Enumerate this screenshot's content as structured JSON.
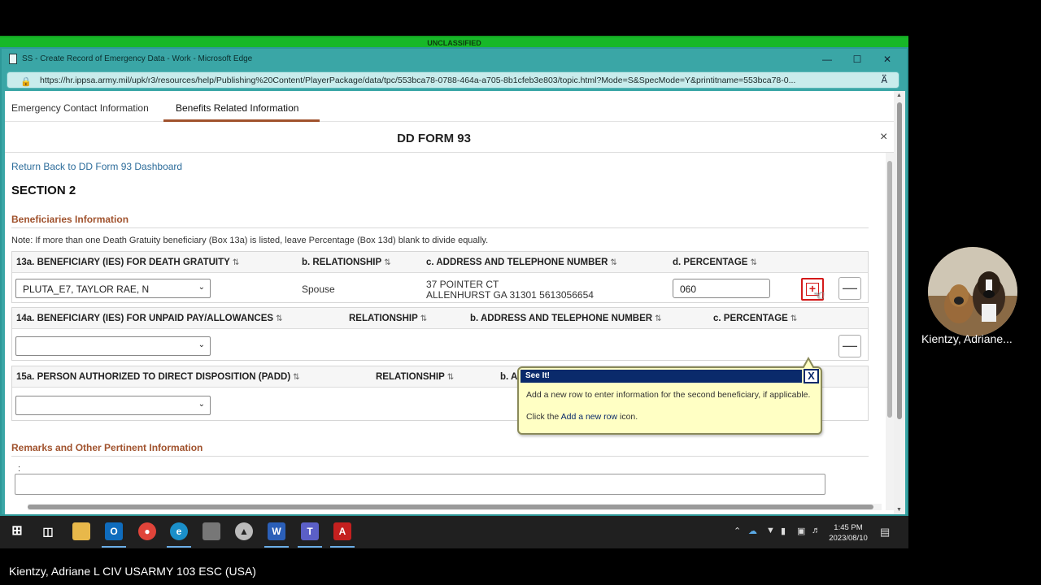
{
  "classification": "UNCLASSIFIED",
  "browser": {
    "title": "SS - Create Record of Emergency Data - Work - Microsoft Edge",
    "url": "https://hr.ippsa.army.mil/upk/r3/resources/help/Publishing%20Content/PlayerPackage/data/tpc/553bca78-0788-464a-a705-8b1cfeb3e803/topic.html?Mode=S&SpecMode=Y&printitname=553bca78-0...",
    "minimize": "—",
    "maximize": "☐",
    "close": "✕"
  },
  "tabs": [
    {
      "label": "Emergency Contact Information"
    },
    {
      "label": "Benefits Related Information"
    }
  ],
  "modal": {
    "title": "DD FORM 93",
    "close": "×",
    "return_link": "Return Back to DD Form 93 Dashboard",
    "section": "SECTION 2",
    "beneficiaries_heading": "Beneficiaries Information",
    "note": "Note: If more than one Death Gratuity beneficiary (Box 13a) is listed, leave Percentage (Box 13d) blank to divide equally.",
    "grid13": {
      "headers": [
        "13a. BENEFICIARY (IES) FOR DEATH GRATUITY",
        "b. RELATIONSHIP",
        "c. ADDRESS AND TELEPHONE NUMBER",
        "d. PERCENTAGE"
      ],
      "sort_glyph": "⇅",
      "beneficiary": "PLUTA_E7, TAYLOR RAE, N",
      "relationship": "Spouse",
      "address_line1": "37 POINTER CT",
      "address_line2": "ALLENHURST GA 31301 5613056654",
      "percentage": "060"
    },
    "grid14": {
      "headers": [
        "14a. BENEFICIARY (IES) FOR UNPAID PAY/ALLOWANCES",
        "RELATIONSHIP",
        "b. ADDRESS AND TELEPHONE NUMBER",
        "c. PERCENTAGE"
      ],
      "beneficiary": ""
    },
    "grid15": {
      "headers": [
        "15a. PERSON AUTHORIZED TO DIRECT DISPOSITION (PADD)",
        "RELATIONSHIP",
        "b. A"
      ],
      "person": ""
    },
    "remarks_heading": "Remarks and Other Pertinent Information",
    "remarks_label": ":",
    "remarks_value": ""
  },
  "see_it": {
    "header": "See It!",
    "close": "X",
    "line1": "Add a new row to enter information for the second beneficiary, if applicable.",
    "line2_prefix": "Click the ",
    "line2_link": "Add a new row",
    "line2_suffix": " icon."
  },
  "taskbar": {
    "time": "1:45 PM",
    "date": "2023/08/10"
  },
  "participant": {
    "name": "Kientzy, Adriane..."
  },
  "presenter": {
    "name": "Kientzy, Adriane L CIV USARMY 103 ESC (USA)"
  },
  "colors": {
    "classification_bar": "#17b828",
    "edge_teal": "#3aa6a6",
    "section_accent": "#a0522d",
    "link": "#2c6c9a",
    "highlight_red": "#d41a1a",
    "bubble_bg": "#ffffc4",
    "bubble_header": "#0a2a6b"
  }
}
